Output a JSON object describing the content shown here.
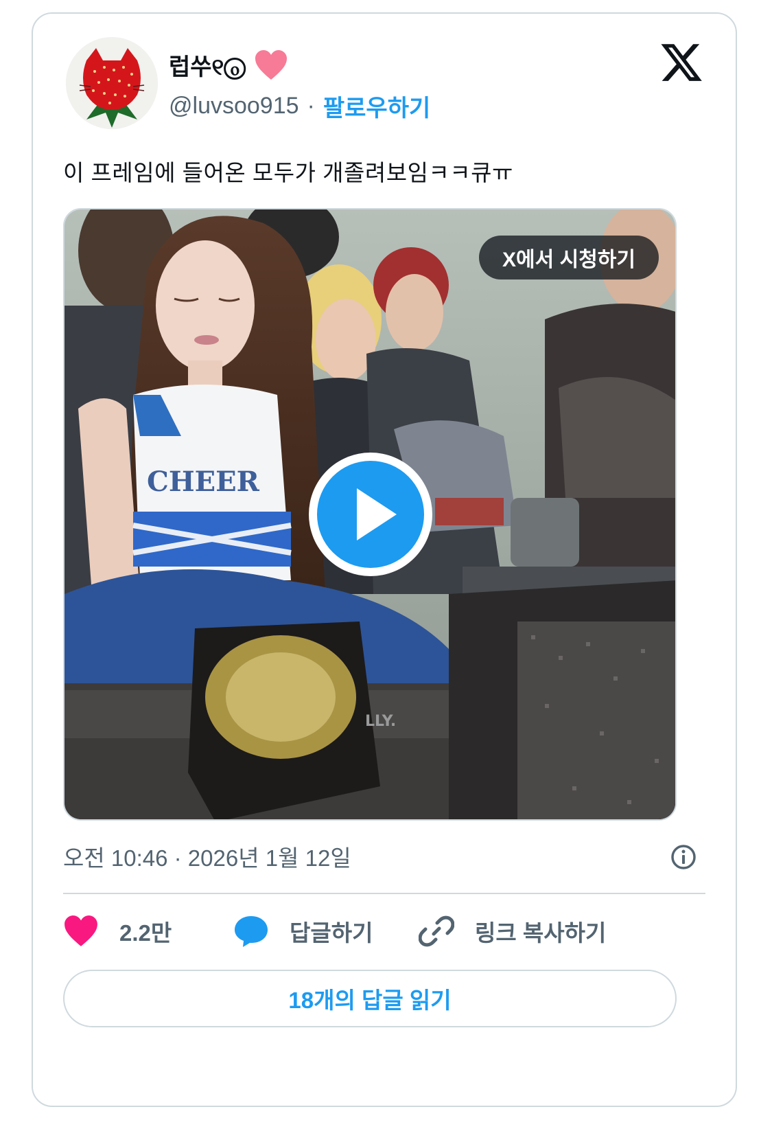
{
  "tweet": {
    "author": {
      "display_name": "럽쑤୧ⓞ",
      "handle": "@luvsoo915",
      "verified_emoji": "pink-heart-icon",
      "avatar": "strawberry-cat-avatar"
    },
    "separator": "·",
    "follow_label": "팔로우하기",
    "logo": "x-logo-icon",
    "text": "이 프레임에 들어온 모두가 개졸려보임ㅋㅋ큐ㅠ",
    "media": {
      "watch_on_x_label": "X에서 시청하기",
      "play_icon": "play-icon",
      "accent_color": "#1d9bf0"
    },
    "timestamp": "오전 10:46 · 2026년 1월 12일",
    "info_icon": "info-icon",
    "actions": {
      "like_count": "2.2만",
      "reply_label": "답글하기",
      "copy_link_label": "링크 복사하기"
    },
    "read_replies_label": "18개의 답글 읽기",
    "colors": {
      "like": "#f91880",
      "link_blue": "#1d9bf0",
      "muted_text": "#536471"
    }
  }
}
